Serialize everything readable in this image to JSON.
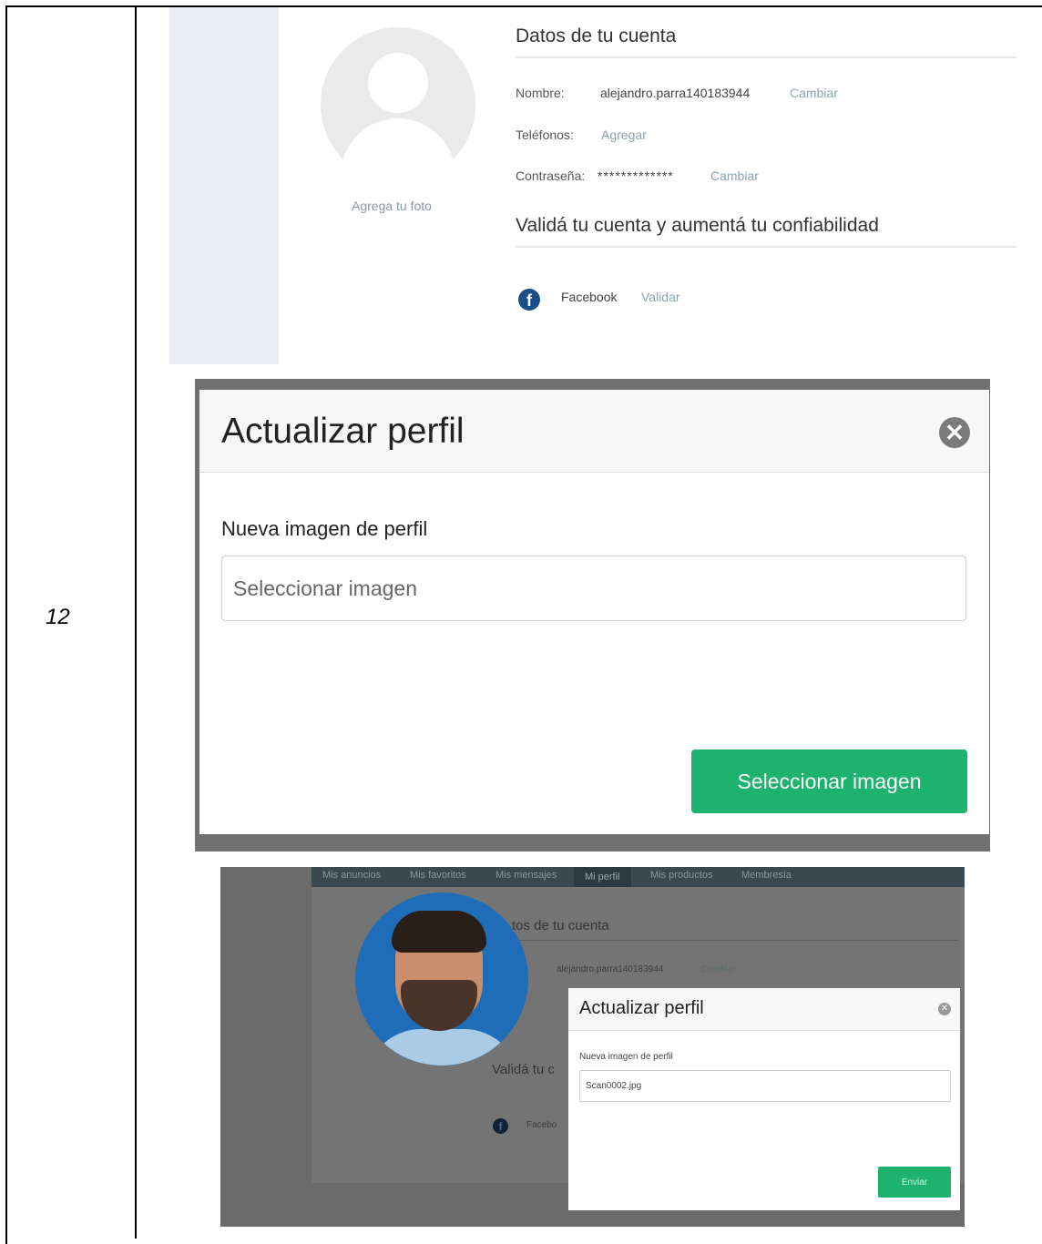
{
  "row": {
    "number": "12"
  },
  "screenshot1": {
    "add_photo": "Agrega tu foto",
    "account_section_title": "Datos de tu cuenta",
    "fields": {
      "name_label": "Nombre:",
      "name_value": "alejandro.parra140183944",
      "name_action": "Cambiar",
      "phones_label": "Teléfonos:",
      "phones_action": "Agregar",
      "password_label": "Contraseña:",
      "password_value": "*************",
      "password_action": "Cambiar"
    },
    "validate_section_title": "Validá tu cuenta y aumentá tu confiabilidad",
    "facebook": {
      "icon": "facebook-icon",
      "label": "Facebook",
      "action": "Validar"
    }
  },
  "screenshot2": {
    "modal_title": "Actualizar perfil",
    "close_icon": "close-circle-icon",
    "field_label": "Nueva imagen de perfil",
    "input_placeholder": "Seleccionar imagen",
    "button_label": "Seleccionar imagen"
  },
  "screenshot3": {
    "nav_tabs": [
      "Mis anuncios",
      "Mis favoritos",
      "Mis mensajes",
      "Mi perfil",
      "Mis productos",
      "Membresía"
    ],
    "active_tab": "Mi perfil",
    "behind_title": "tos de tu cuenta",
    "behind_name": "alejandro.parra140183944",
    "behind_name_action": "Cambiar",
    "behind_validate": "Validá tu c",
    "behind_facebook": "Facebo",
    "modal_title": "Actualizar perfil",
    "field_label": "Nueva imagen de perfil",
    "input_value": "Scan0002.jpg",
    "button_label": "Enviar"
  },
  "colors": {
    "accent_green": "#1db36f",
    "link_blue_grey": "#8aa4b2",
    "facebook_blue": "#1b4f8a"
  }
}
